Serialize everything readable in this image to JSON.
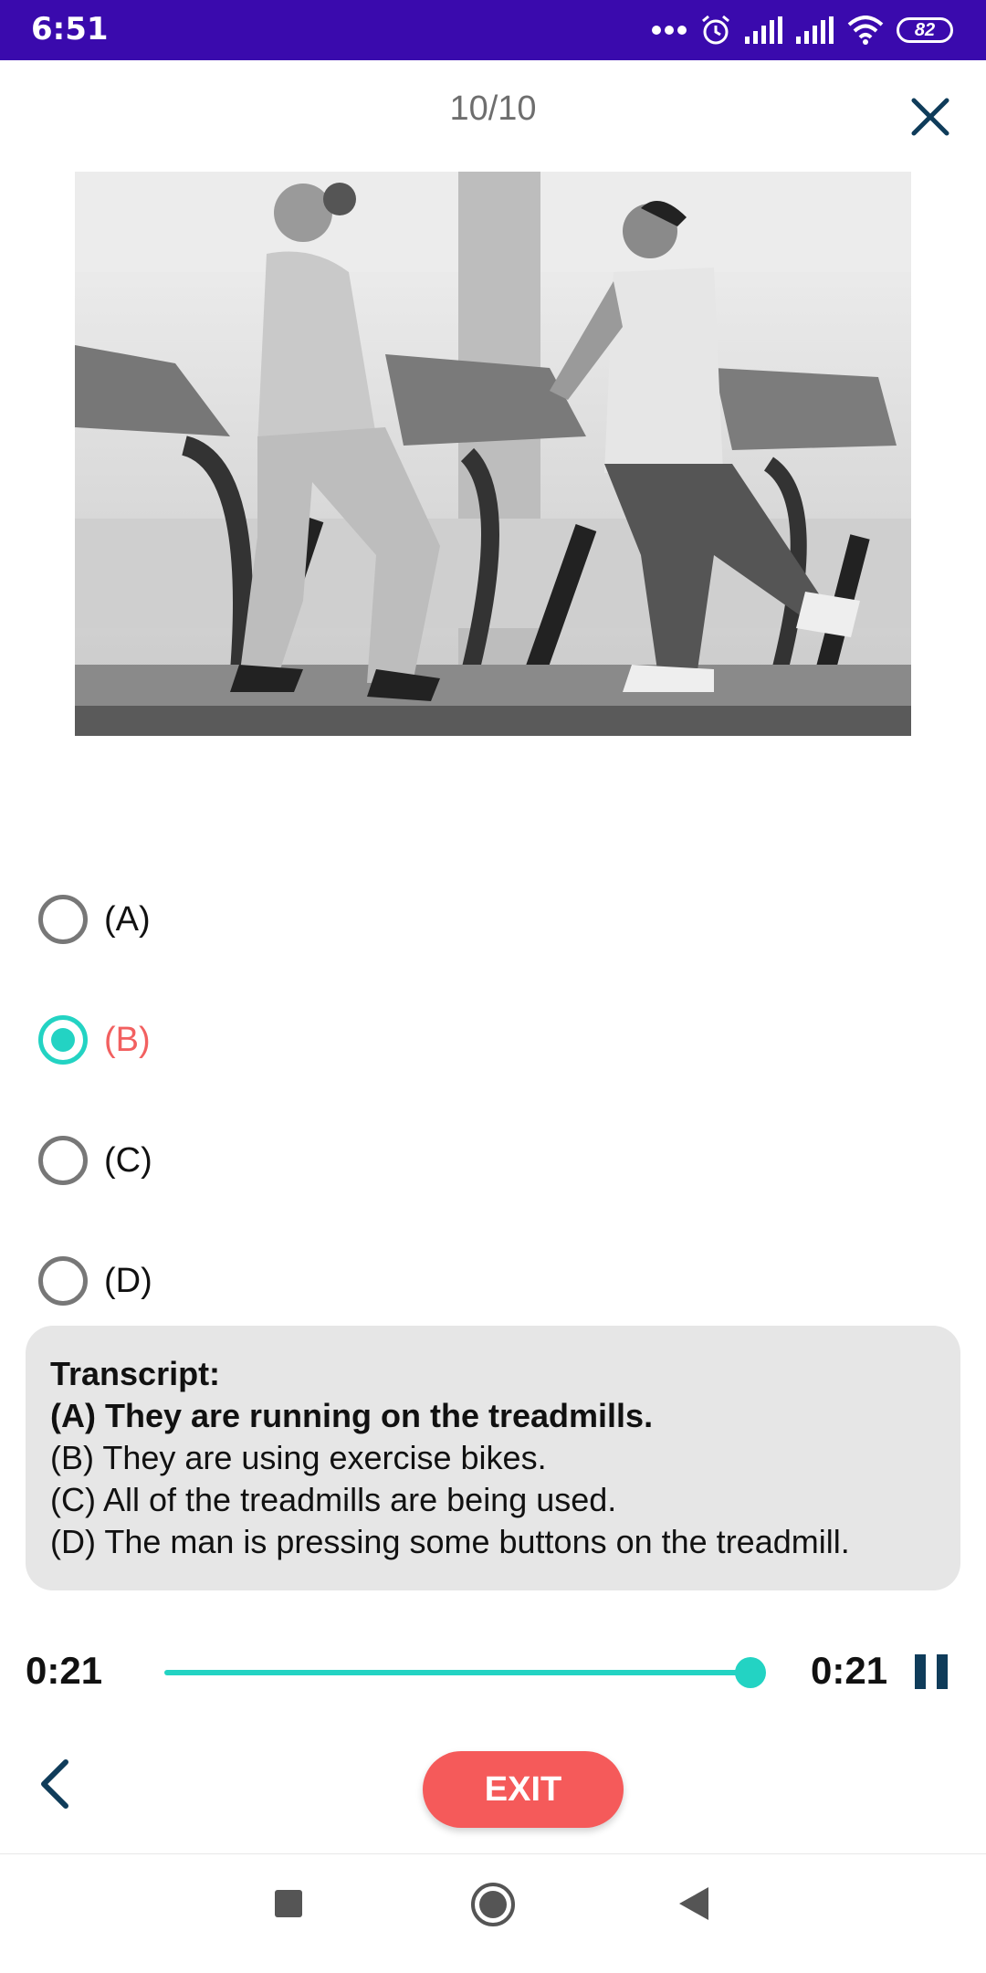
{
  "status_bar": {
    "time": "6:51",
    "battery": "82",
    "icons": [
      "dots-icon",
      "alarm-icon",
      "signal-icon",
      "signal-icon",
      "wifi-icon",
      "battery-icon"
    ],
    "color": "#3a0aad"
  },
  "header": {
    "progress": "10/10",
    "close_icon": "close-icon"
  },
  "question_image": {
    "icon": "photo-treadmill-runners"
  },
  "options": [
    {
      "label": "(A)",
      "selected": false
    },
    {
      "label": "(B)",
      "selected": true
    },
    {
      "label": "(C)",
      "selected": false
    },
    {
      "label": "(D)",
      "selected": false
    }
  ],
  "transcript": {
    "heading": "Transcript:",
    "lines": [
      "(A) They are running on the treadmills.",
      "(B) They are using exercise bikes.",
      "(C) All of the treadmills are being used.",
      "(D) The man is pressing some buttons on the treadmill."
    ]
  },
  "player": {
    "elapsed": "0:21",
    "duration": "0:21",
    "progress": 1.0,
    "accent_color": "#23d3c3",
    "pause_icon": "pause-icon"
  },
  "footer": {
    "back_icon": "chevron-left-icon",
    "exit_label": "EXIT",
    "exit_color": "#f55a5a"
  },
  "nav_bar": {
    "icons": [
      "recents-square-icon",
      "home-circle-icon",
      "back-triangle-icon"
    ]
  }
}
